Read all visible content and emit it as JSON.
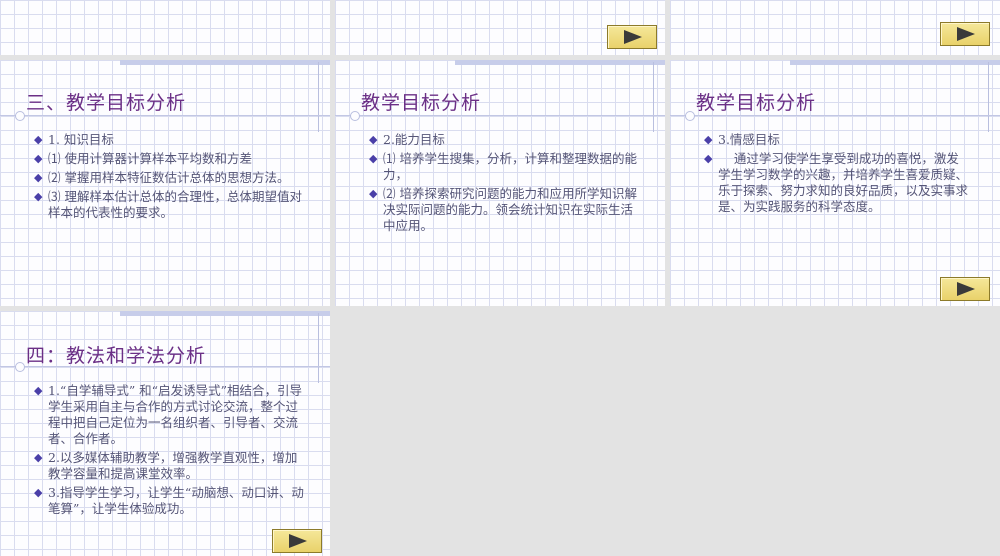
{
  "top_slides": [
    {
      "has_button": false
    },
    {
      "has_button": true,
      "button_label": "next"
    },
    {
      "has_button": true,
      "button_label": "next"
    }
  ],
  "slide1": {
    "title": "三、教学目标分析",
    "items": [
      {
        "bullet": "◆",
        "text": "1.  知识目标"
      },
      {
        "bullet": "◆",
        "text": "⑴  使用计算器计算样本平均数和方差"
      },
      {
        "bullet": "◆",
        "text": "⑵  掌握用样本特征数估计总体的思想方法。"
      },
      {
        "bullet": "◆",
        "text": "⑶  理解样本估计总体的合理性，总体期望值对样本的代表性的要求。"
      }
    ]
  },
  "slide2": {
    "title": "教学目标分析",
    "items": [
      {
        "bullet": "◆",
        "text": "2.能力目标"
      },
      {
        "bullet": "◆",
        "text": "⑴ 培养学生搜集，分析，计算和整理数据的能力，"
      },
      {
        "bullet": "◆",
        "text": "⑵ 培养探索研究问题的能力和应用所学知识解决实际问题的能力。领会统计知识在实际生活中应用。"
      }
    ]
  },
  "slide3": {
    "title": "教学目标分析",
    "items": [
      {
        "bullet": "◆",
        "text": "3.情感目标"
      },
      {
        "bullet": "◆",
        "text": "    通过学习使学生享受到成功的喜悦，激发学生学习数学的兴趣，并培养学生喜爱质疑、乐于探索、努力求知的良好品质，以及实事求是、为实践服务的科学态度。"
      }
    ]
  },
  "slide4": {
    "title": "四：教法和学法分析",
    "items": [
      {
        "bullet": "◆",
        "text": "1.“自学辅导式” 和“启发诱导式”相结合，引导学生采用自主与合作的方式讨论交流，整个过程中把自己定位为一名组织者、引导者、交流者、合作者。"
      },
      {
        "bullet": "◆",
        "text": "2.以多媒体辅助教学，增强教学直观性，增加教学容量和提高课堂效率。"
      },
      {
        "bullet": "◆",
        "text": "3.指导学生学习，让学生“动脑想、动口讲、动笔算”，让学生体验成功。"
      }
    ]
  },
  "colors": {
    "title": "#6b2f86",
    "body_text": "#555577",
    "bullet": "#4a3fa8",
    "button_fill": "#ecd779",
    "background": "#e3e3e3"
  },
  "icons": {
    "play": "play-triangle-icon"
  }
}
